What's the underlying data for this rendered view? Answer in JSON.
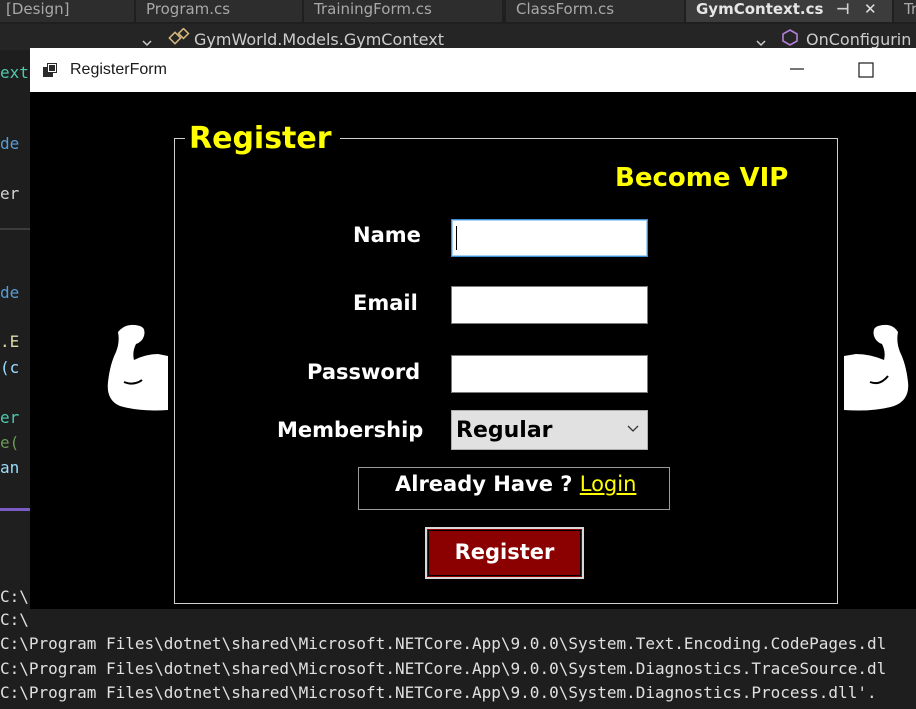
{
  "ide": {
    "tabs": [
      {
        "label": "[Design]"
      },
      {
        "label": "Program.cs"
      },
      {
        "label": "TrainingForm.cs"
      },
      {
        "label": "ClassForm.cs"
      },
      {
        "label": "GymContext.cs"
      },
      {
        "label": "Tra"
      }
    ],
    "active_tab_pin": "⊣",
    "active_tab_close": "✕",
    "navbar": {
      "left_dropdown": "",
      "middle": "GymWorld.Models.GymContext",
      "right": "OnConfigurin"
    },
    "code_fragments": [
      {
        "text": "ext",
        "color": "#4ec9b0"
      },
      {
        "text": "de",
        "color": "#569cd6"
      },
      {
        "text": "er",
        "color": "#d4d4d4"
      },
      {
        "text": "de",
        "color": "#569cd6"
      },
      {
        "text": ".E",
        "color": "#dcdcaa"
      },
      {
        "text": "(c",
        "color": "#9cdcfe"
      },
      {
        "text": "er",
        "color": "#4ec9b0"
      },
      {
        "text": "e(",
        "color": "#6a9955"
      },
      {
        "text": "an",
        "color": "#9cdcfe"
      }
    ],
    "output_lines": [
      "C:\\",
      "C:\\",
      "C:\\Program Files\\dotnet\\shared\\Microsoft.NETCore.App\\9.0.0\\System.Text.Encoding.CodePages.dl",
      "C:\\Program Files\\dotnet\\shared\\Microsoft.NETCore.App\\9.0.0\\System.Diagnostics.TraceSource.dl",
      "C:\\Program Files\\dotnet\\shared\\Microsoft.NETCore.App\\9.0.0\\System.Diagnostics.Process.dll'."
    ]
  },
  "window": {
    "title": "RegisterForm",
    "minimize_glyph": "—",
    "maximize_glyph": "☐"
  },
  "form": {
    "group_title": "Register",
    "promo": "Become VIP",
    "labels": {
      "name": "Name",
      "email": "Email",
      "password": "Password",
      "membership": "Membership"
    },
    "fields": {
      "name_value": "",
      "email_value": "",
      "password_value": ""
    },
    "membership_selected": "Regular",
    "already_have_text": "Already Have ?",
    "login_link": "Login",
    "register_button": "Register"
  },
  "colors": {
    "accent_yellow": "#ffff00",
    "button_red": "#8b0000",
    "window_bg": "#000000"
  }
}
